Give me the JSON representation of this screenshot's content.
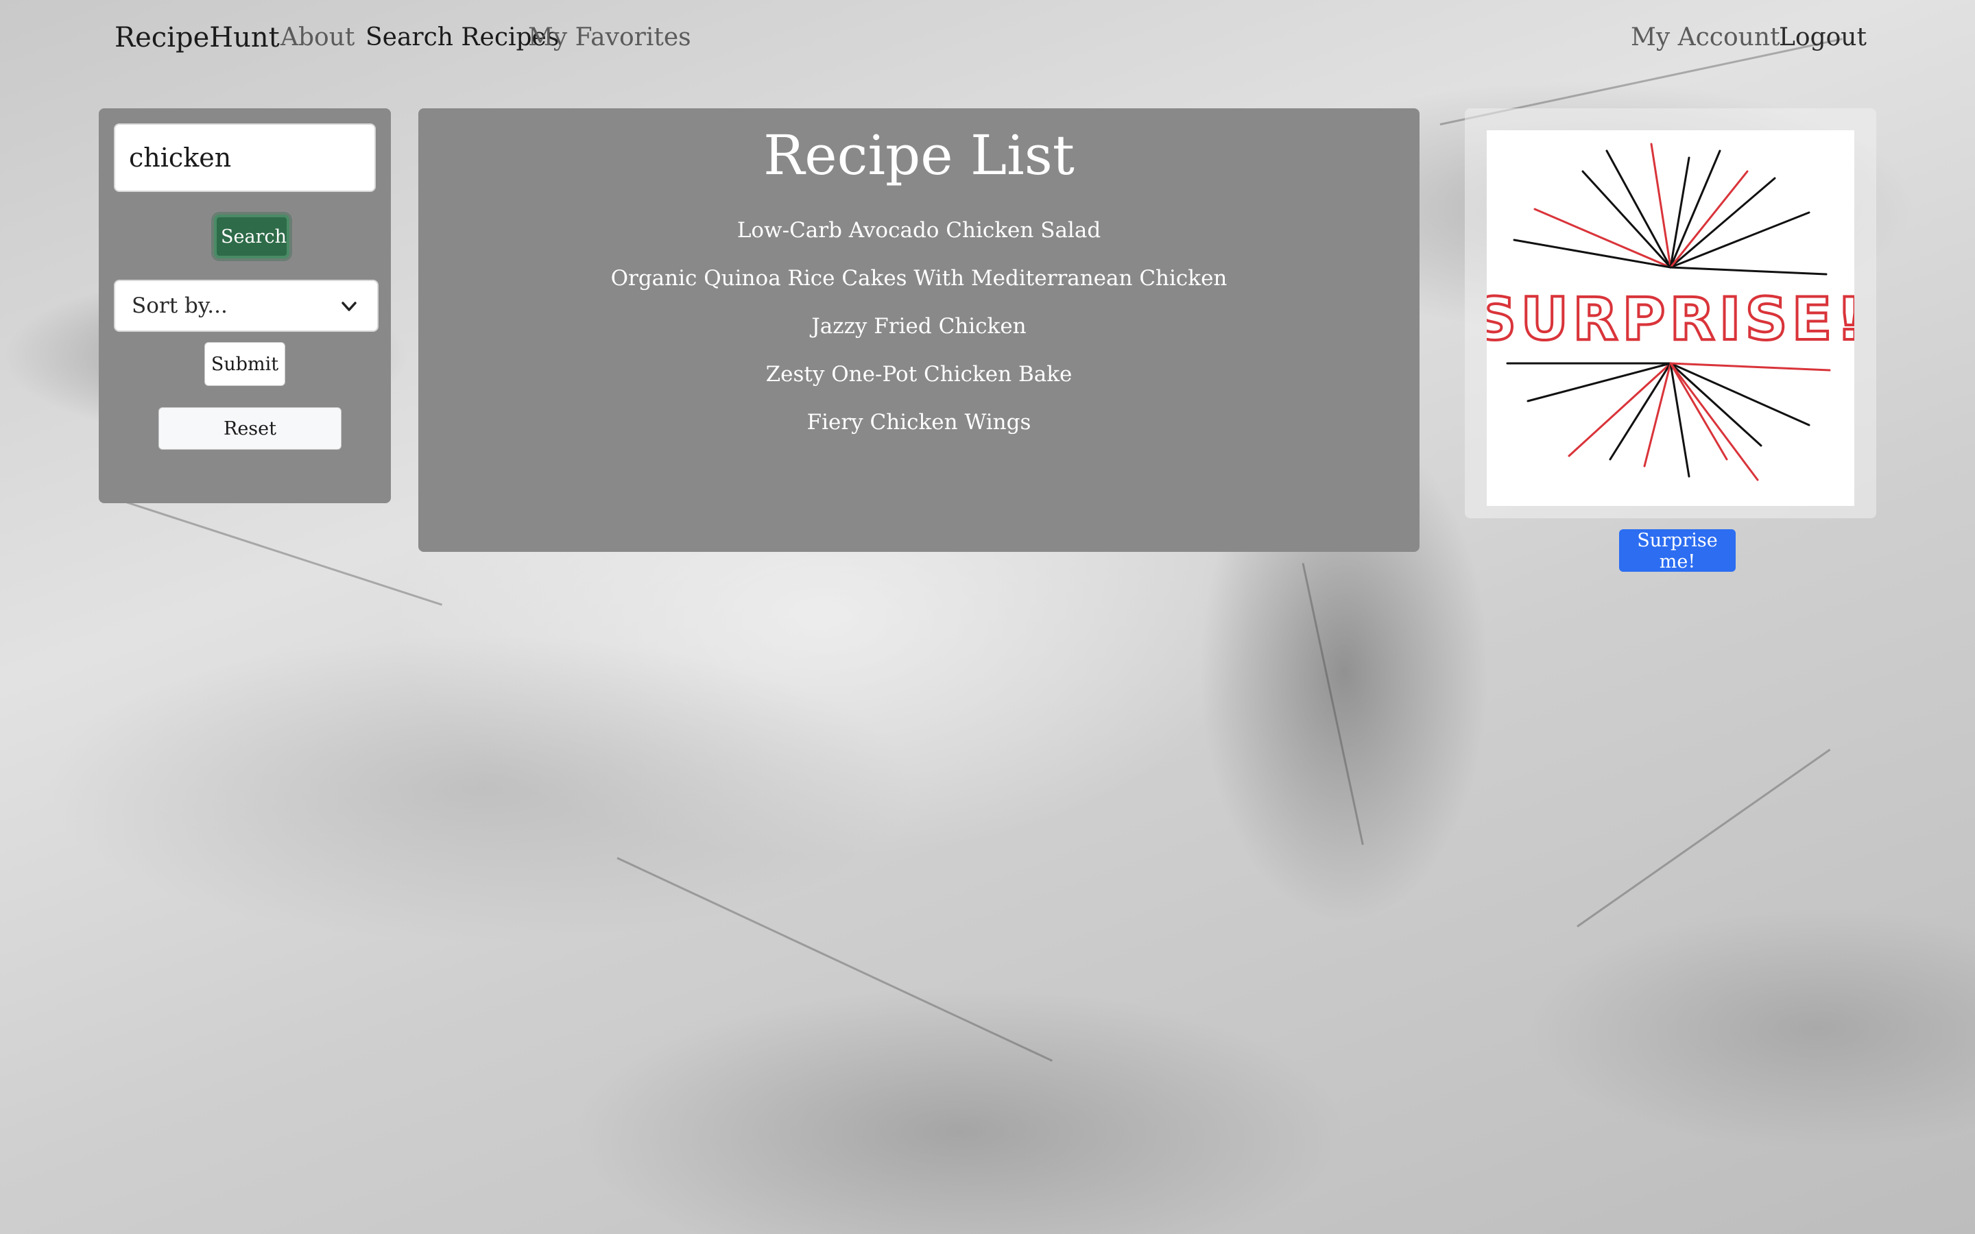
{
  "app": {
    "brand": "RecipeHunt"
  },
  "nav": {
    "about": "About",
    "search_recipes": "Search Recipes",
    "my_favorites": "My Favorites",
    "my_account": "My Account",
    "logout": "Logout"
  },
  "sidebar": {
    "search_value": "chicken",
    "search_button": "Search",
    "sort_placeholder": "Sort by...",
    "submit_button": "Submit",
    "reset_button": "Reset"
  },
  "main": {
    "title": "Recipe List",
    "recipes": [
      "Low-Carb Avocado Chicken Salad",
      "Organic Quinoa Rice Cakes With Mediterranean Chicken",
      "Jazzy Fried Chicken",
      "Zesty One-Pot Chicken Bake",
      "Fiery Chicken Wings"
    ]
  },
  "surprise": {
    "image_text": "SURPRISE!",
    "button": "Surprise me!"
  },
  "colors": {
    "search_button": "#2e6b48",
    "surprise_button": "#2c6df1",
    "panel": "#8a898a",
    "surprise_text": "#d9343a"
  },
  "icons": {
    "sort_chevron": "chevron-down-icon"
  }
}
